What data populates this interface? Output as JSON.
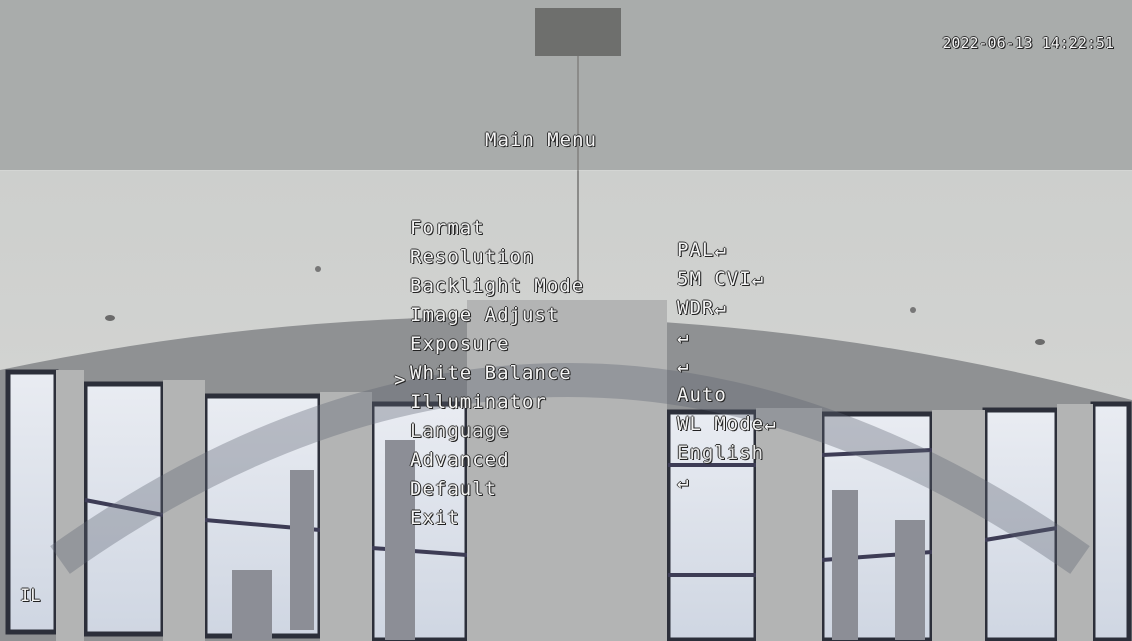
{
  "timestamp": "2022-06-13 14:22:51",
  "menu": {
    "title": "Main Menu",
    "items": [
      {
        "cursor": "",
        "label": "Format",
        "value": "PAL↵"
      },
      {
        "cursor": "",
        "label": "Resolution",
        "value": "5M CVI↵"
      },
      {
        "cursor": "",
        "label": "Backlight Mode",
        "value": "WDR↵"
      },
      {
        "cursor": "",
        "label": "Image Adjust",
        "value": "↵"
      },
      {
        "cursor": "",
        "label": "Exposure",
        "value": "↵"
      },
      {
        "cursor": "",
        "label": "White Balance",
        "value": "Auto"
      },
      {
        "cursor": ">",
        "label": "Illuminator",
        "value": "WL Mode↵"
      },
      {
        "cursor": "",
        "label": "Language",
        "value": "English"
      },
      {
        "cursor": "",
        "label": "Advanced",
        "value": "↵"
      },
      {
        "cursor": "",
        "label": "Default",
        "value": ""
      },
      {
        "cursor": "",
        "label": "Exit",
        "value": ""
      }
    ],
    "selected_index": 6
  },
  "corner_tag": "IL"
}
